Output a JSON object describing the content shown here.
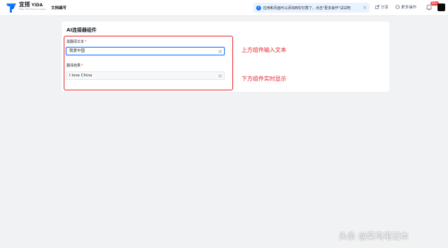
{
  "header": {
    "brand_name": "宜搭",
    "brand_name_en": "YiDA",
    "brand_tagline": "Make Work Easy & Happy",
    "nav_title": "文档编写",
    "notice_text": "应用和页面可以添加到钉钉群了，点击\"更多操作\"试试吧",
    "share_label": "分享",
    "more_label": "更多操作",
    "badge_text": "99+"
  },
  "card": {
    "title": "AI连接器组件",
    "fields": [
      {
        "label": "需翻译文本",
        "value": "我爱中国"
      },
      {
        "label": "翻译结果",
        "value": "I love China"
      }
    ]
  },
  "annotations": {
    "top": "上方组件输入文本",
    "bottom": "下方组件实时显示"
  },
  "watermark": "头条 @菜鸟笔记本",
  "colors": {
    "accent": "#1677ff",
    "annotation": "#e6242a",
    "notice_bg": "#e8f3ff"
  }
}
